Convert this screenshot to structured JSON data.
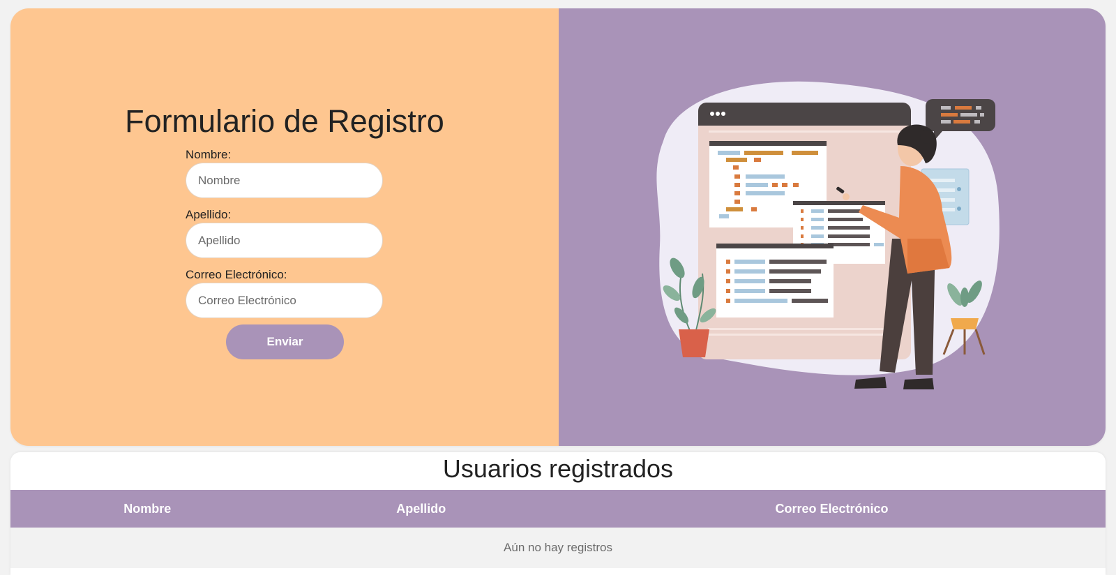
{
  "form": {
    "title": "Formulario de Registro",
    "fields": [
      {
        "label": "Nombre:",
        "placeholder": "Nombre",
        "value": ""
      },
      {
        "label": "Apellido:",
        "placeholder": "Apellido",
        "value": ""
      },
      {
        "label": "Correo Electrónico:",
        "placeholder": "Correo Electrónico",
        "value": ""
      }
    ],
    "submit_label": "Enviar"
  },
  "users": {
    "title": "Usuarios registrados",
    "columns": [
      "Nombre",
      "Apellido",
      "Correo Electrónico"
    ],
    "empty_message": "Aún no hay registros"
  },
  "colors": {
    "form_bg": "#fec690",
    "accent": "#a993b8",
    "input_bg": "#ffffff",
    "row_bg": "#f2f2f2"
  },
  "icons": {
    "illustration": "developer-coding-illustration"
  }
}
